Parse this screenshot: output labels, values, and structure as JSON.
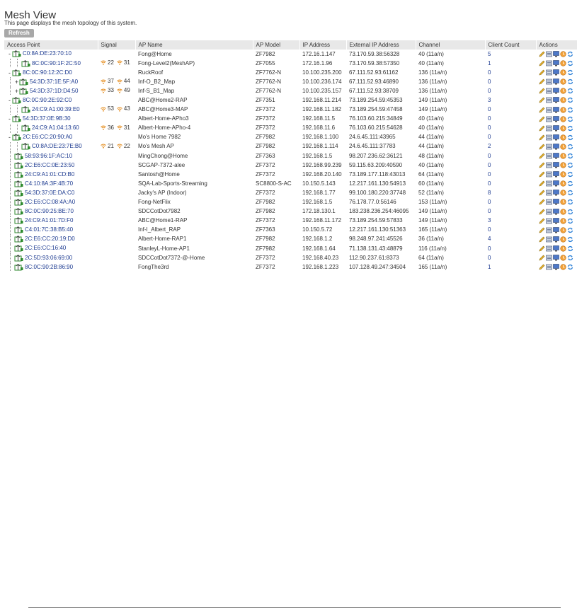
{
  "page": {
    "title": "Mesh View",
    "description": "This page displays the mesh topology of this system.",
    "refresh_label": "Refresh"
  },
  "table": {
    "headers": [
      "Access Point",
      "Signal",
      "AP Name",
      "AP Model",
      "IP Address",
      "External IP Address",
      "Channel",
      "Client Count",
      "Actions"
    ],
    "rows": [
      {
        "depth": 0,
        "toggle": "-",
        "mac": "C0:8A:DE:23:70:10",
        "sig1": "",
        "sig2": "",
        "name": "Fong@Home",
        "model": "ZF7982",
        "ip": "172.16.1.147",
        "ext": "73.170.59.38:56328",
        "channel": "40 (11a/n)",
        "clients": "5"
      },
      {
        "depth": 1,
        "toggle": "",
        "mac": "8C:0C:90:1F:2C:50",
        "sig1": "22",
        "sig2": "31",
        "name": "Fong-Level2(MeshAP)",
        "model": "ZF7055",
        "ip": "172.16.1.96",
        "ext": "73.170.59.38:57350",
        "channel": "40 (11a/n)",
        "clients": "1"
      },
      {
        "depth": 0,
        "toggle": "-",
        "mac": "8C:0C:90:12:2C:D0",
        "sig1": "",
        "sig2": "",
        "name": "RuckRoof",
        "model": "ZF7762-N",
        "ip": "10.100.235.200",
        "ext": "67.111.52.93:61162",
        "channel": "136 (11a/n)",
        "clients": "0"
      },
      {
        "depth": 1,
        "toggle": "+",
        "mac": "54:3D:37:1E:5F:A0",
        "sig1": "37",
        "sig2": "44",
        "name": "Inf-O_B2_Map",
        "model": "ZF7762-N",
        "ip": "10.100.236.174",
        "ext": "67.111.52.93:46890",
        "channel": "136 (11a/n)",
        "clients": "0"
      },
      {
        "depth": 1,
        "toggle": "+",
        "mac": "54:3D:37:1D:D4:50",
        "sig1": "33",
        "sig2": "49",
        "name": "Inf-S_B1_Map",
        "model": "ZF7762-N",
        "ip": "10.100.235.157",
        "ext": "67.111.52.93:38709",
        "channel": "136 (11a/n)",
        "clients": "0"
      },
      {
        "depth": 0,
        "toggle": "-",
        "mac": "8C:0C:90:2E:92:C0",
        "sig1": "",
        "sig2": "",
        "name": "ABC@Home2-RAP",
        "model": "ZF7351",
        "ip": "192.168.11.214",
        "ext": "73.189.254.59:45353",
        "channel": "149 (11a/n)",
        "clients": "3"
      },
      {
        "depth": 1,
        "toggle": "",
        "mac": "24:C9:A1:00:39:E0",
        "sig1": "53",
        "sig2": "43",
        "name": "ABC@Home3-MAP",
        "model": "ZF7372",
        "ip": "192.168.11.182",
        "ext": "73.189.254.59:47458",
        "channel": "149 (11a/n)",
        "clients": "0"
      },
      {
        "depth": 0,
        "toggle": "-",
        "mac": "54:3D:37:0E:9B:30",
        "sig1": "",
        "sig2": "",
        "name": "Albert-Home-APho3",
        "model": "ZF7372",
        "ip": "192.168.11.5",
        "ext": "76.103.60.215:34849",
        "channel": "40 (11a/n)",
        "clients": "0"
      },
      {
        "depth": 1,
        "toggle": "",
        "mac": "24:C9:A1:04:13:60",
        "sig1": "36",
        "sig2": "31",
        "name": "Albert-Home-APho-4",
        "model": "ZF7372",
        "ip": "192.168.11.6",
        "ext": "76.103.60.215:54628",
        "channel": "40 (11a/n)",
        "clients": "0"
      },
      {
        "depth": 0,
        "toggle": "-",
        "mac": "2C:E6:CC:20:90:A0",
        "sig1": "",
        "sig2": "",
        "name": "Mo's Home 7982",
        "model": "ZF7982",
        "ip": "192.168.1.100",
        "ext": "24.6.45.111:43965",
        "channel": "44 (11a/n)",
        "clients": "0"
      },
      {
        "depth": 1,
        "toggle": "",
        "mac": "C0:8A:DE:23:7E:B0",
        "sig1": "21",
        "sig2": "22",
        "name": "Mo's Mesh AP",
        "model": "ZF7982",
        "ip": "192.168.1.114",
        "ext": "24.6.45.111:37783",
        "channel": "44 (11a/n)",
        "clients": "2"
      },
      {
        "depth": 0,
        "toggle": "",
        "mac": "58:93:96:1F:AC:10",
        "sig1": "",
        "sig2": "",
        "name": "MingChong@Home",
        "model": "ZF7363",
        "ip": "192.168.1.5",
        "ext": "98.207.236.62:36121",
        "channel": "48 (11a/n)",
        "clients": "0"
      },
      {
        "depth": 0,
        "toggle": "",
        "mac": "2C:E6:CC:0E:23:50",
        "sig1": "",
        "sig2": "",
        "name": "SCGAP-7372-alee",
        "model": "ZF7372",
        "ip": "192.168.99.239",
        "ext": "59.115.63.209:40590",
        "channel": "40 (11a/n)",
        "clients": "0"
      },
      {
        "depth": 0,
        "toggle": "",
        "mac": "24:C9:A1:01:CD:B0",
        "sig1": "",
        "sig2": "",
        "name": "Santosh@Home",
        "model": "ZF7372",
        "ip": "192.168.20.140",
        "ext": "73.189.177.118:43013",
        "channel": "64 (11a/n)",
        "clients": "0"
      },
      {
        "depth": 0,
        "toggle": "",
        "mac": "C4:10:8A:3F:4B:70",
        "sig1": "",
        "sig2": "",
        "name": "SQA-Lab-Sports-Streaming",
        "model": "SC8800-S-AC",
        "ip": "10.150.5.143",
        "ext": "12.217.161.130:54913",
        "channel": "60 (11a/n)",
        "clients": "0"
      },
      {
        "depth": 0,
        "toggle": "",
        "mac": "54:3D:37:0E:DA:C0",
        "sig1": "",
        "sig2": "",
        "name": "Jacky's AP (Indoor)",
        "model": "ZF7372",
        "ip": "192.168.1.77",
        "ext": "99.100.180.220:37748",
        "channel": "52 (11a/n)",
        "clients": "8"
      },
      {
        "depth": 0,
        "toggle": "",
        "mac": "2C:E6:CC:08:4A:A0",
        "sig1": "",
        "sig2": "",
        "name": "Fong-NetFlix",
        "model": "ZF7982",
        "ip": "192.168.1.5",
        "ext": "76.178.77.0:56146",
        "channel": "153 (11a/n)",
        "clients": "0"
      },
      {
        "depth": 0,
        "toggle": "",
        "mac": "8C:0C:90:25:BE:70",
        "sig1": "",
        "sig2": "",
        "name": "SDCCotDot7982",
        "model": "ZF7982",
        "ip": "172.18.130.1",
        "ext": "183.238.236.254:46095",
        "channel": "149 (11a/n)",
        "clients": "0"
      },
      {
        "depth": 0,
        "toggle": "",
        "mac": "24:C9:A1:01:7D:F0",
        "sig1": "",
        "sig2": "",
        "name": "ABC@Home1-RAP",
        "model": "ZF7372",
        "ip": "192.168.11.172",
        "ext": "73.189.254.59:57833",
        "channel": "149 (11a/n)",
        "clients": "3"
      },
      {
        "depth": 0,
        "toggle": "",
        "mac": "C4:01:7C:38:B5:40",
        "sig1": "",
        "sig2": "",
        "name": "Inf-I_Albert_RAP",
        "model": "ZF7363",
        "ip": "10.150.5.72",
        "ext": "12.217.161.130:51363",
        "channel": "165 (11a/n)",
        "clients": "0"
      },
      {
        "depth": 0,
        "toggle": "",
        "mac": "2C:E6:CC:20:19:D0",
        "sig1": "",
        "sig2": "",
        "name": "Albert-Home-RAP1",
        "model": "ZF7982",
        "ip": "192.168.1.2",
        "ext": "98.248.97.241:45526",
        "channel": "36 (11a/n)",
        "clients": "4"
      },
      {
        "depth": 0,
        "toggle": "",
        "mac": "2C:E6:CC:16:40",
        "sig1": "",
        "sig2": "",
        "name": "StanleyL-Home-AP1",
        "model": "ZF7982",
        "ip": "192.168.1.64",
        "ext": "71.138.131.43:48879",
        "channel": "116 (11a/n)",
        "clients": "0"
      },
      {
        "depth": 0,
        "toggle": "",
        "mac": "2C:5D:93:06:69:00",
        "sig1": "",
        "sig2": "",
        "name": "SDCCotDot7372-@-Home",
        "model": "ZF7372",
        "ip": "192.168.40.23",
        "ext": "112.90.237.61:8373",
        "channel": "64 (11a/n)",
        "clients": "0"
      },
      {
        "depth": 0,
        "toggle": "",
        "mac": "8C:0C:90:2B:86:90",
        "sig1": "",
        "sig2": "",
        "name": "FongThe3rd",
        "model": "ZF7372",
        "ip": "192.168.1.223",
        "ext": "107.128.49.247:34504",
        "channel": "165 (11a/n)",
        "clients": "1"
      }
    ]
  },
  "colors": {
    "link": "#1c3a90",
    "header_bg": "#e8e8e8",
    "button_bg": "#a8a8a8",
    "signal": "#e48a18",
    "ap_icon": "#2d8a2d"
  },
  "icons": {
    "ap": "ap-tower-icon",
    "signal": "wifi-signal-icon",
    "actions": [
      "edit-pencil-icon",
      "config-icon",
      "monitor-icon",
      "restart-icon",
      "refresh-arrows-icon"
    ]
  }
}
